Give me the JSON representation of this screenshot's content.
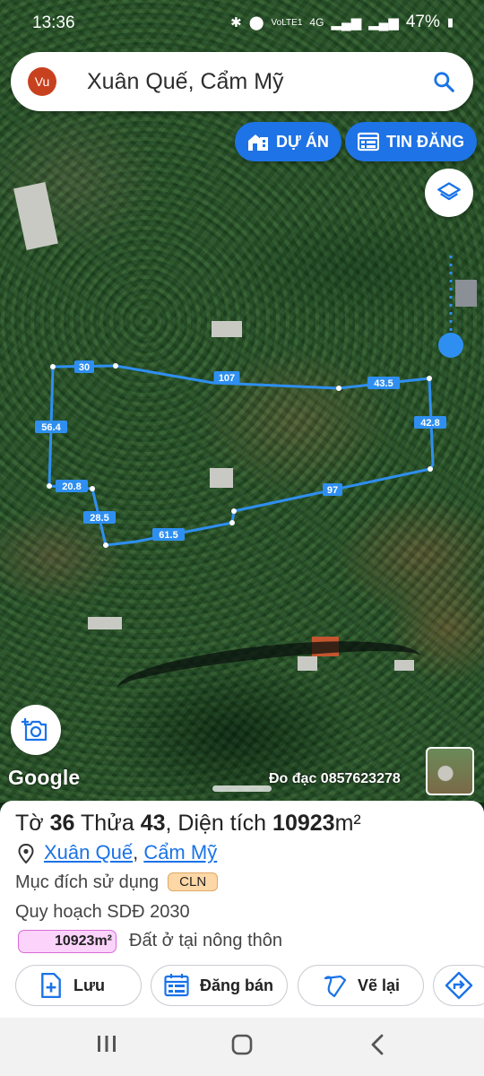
{
  "status": {
    "time": "13:36",
    "battery": "47%",
    "network": "4G",
    "volte": "VoLTE1"
  },
  "search": {
    "avatar": "Vu",
    "query": "Xuân Quế, Cẩm Mỹ",
    "icon": "search-icon"
  },
  "filters": [
    {
      "label": "DỰ ÁN",
      "icon": "building-icon"
    },
    {
      "label": "TIN ĐĂNG",
      "icon": "listing-icon"
    }
  ],
  "map": {
    "edge_labels": [
      "30",
      "107",
      "43.5",
      "42.8",
      "97",
      "61.5",
      "28.5",
      "20.8",
      "56.4"
    ],
    "google_label": "Google",
    "credit": "Đo đạc 0857623278",
    "boundary_color": "#2f8ff0"
  },
  "parcel": {
    "to_label": "Tờ",
    "to_value": "36",
    "thua_label": "Thửa",
    "thua_value": "43",
    "area_label": ", Diện tích",
    "area_value": "10923",
    "area_unit": "m²",
    "commune": "Xuân Quế",
    "district": "Cẩm Mỹ",
    "purpose_label": "Mục đích sử dụng",
    "purpose_code": "CLN",
    "plan_label": "Quy hoạch SDĐ 2030",
    "plan_area": "10923m²",
    "plan_desc": "Đất ở tại nông thôn"
  },
  "actions": [
    {
      "label": "Lưu",
      "icon": "save-icon"
    },
    {
      "label": "Đăng bán",
      "icon": "calendar-icon"
    },
    {
      "label": "Vẽ lại",
      "icon": "redraw-icon"
    },
    {
      "label": "",
      "icon": "directions-icon"
    }
  ]
}
